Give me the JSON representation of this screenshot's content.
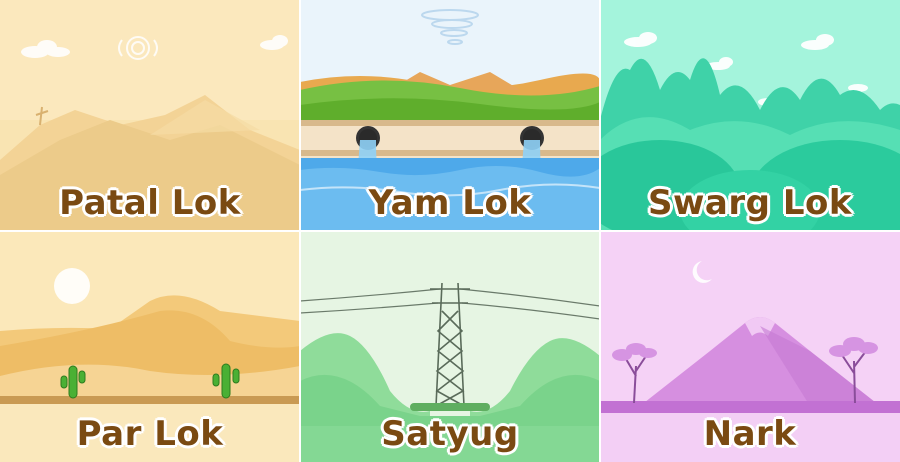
{
  "tiles": [
    {
      "label": "Patal Lok",
      "scene": "desert-mountains",
      "bg": "#f8e2ad"
    },
    {
      "label": "Yam Lok",
      "scene": "river-drains",
      "bg": "#e8f3fb"
    },
    {
      "label": "Swarg Lok",
      "scene": "green-hills",
      "bg": "#9ff5da"
    },
    {
      "label": "Par Lok",
      "scene": "sand-dunes-cactus",
      "bg": "#fae7b7"
    },
    {
      "label": "Satyug",
      "scene": "power-tower-hills",
      "bg": "#e3f3e0"
    },
    {
      "label": "Nark",
      "scene": "purple-volcano",
      "bg": "#f6d4f7"
    }
  ]
}
